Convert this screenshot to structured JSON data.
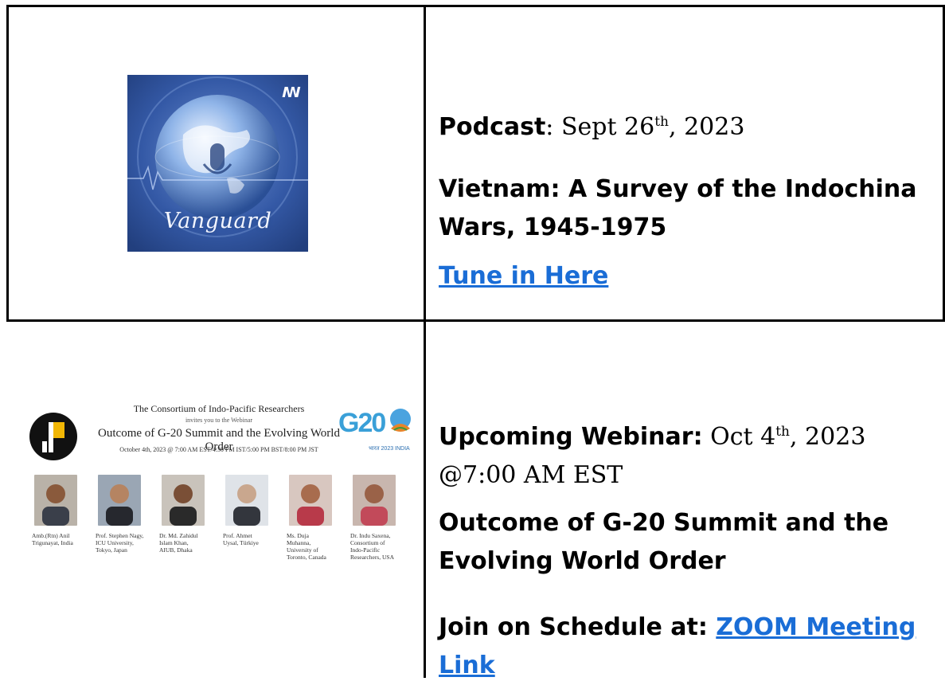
{
  "podcast": {
    "cover_name": "Vanguard",
    "label": "Podcast",
    "date_prefix": ": Sept 26",
    "date_sup": "th",
    "date_suffix": ", 2023",
    "title_line1": "Vietnam: A Survey of the Indochina",
    "title_line2": "Wars, 1945-1975",
    "link": "Tune in Here"
  },
  "webinar": {
    "label": "Upcoming Webinar:",
    "date_prefix": " Oct 4",
    "date_sup": "th",
    "date_suffix": ", 2023",
    "time": "@7:00 AM EST",
    "title_line1": "Outcome of G-20 Summit and the",
    "title_line2": "Evolving World Order",
    "join_label": "Join on Schedule at: ",
    "link_part1": "ZOOM Meeting",
    "link_part2": "Link"
  },
  "flyer": {
    "org": "The Consortium of Indo-Pacific Researchers",
    "invite": "invites you to the Webinar",
    "title": "Outcome of G-20 Summit and the Evolving World Order",
    "date": "October 4th, 2023 @ 7:00 AM EST/4:30 PM IST/5:00 PM BST/8:00 PM JST",
    "g20_mark": "G20",
    "g20_sub": "भारत 2023 INDIA",
    "speakers": [
      "Amb.(Rtn) Anil\nTrigunayat, India",
      "Prof. Stephen Nagy,\nICU University,\nTokyo, Japan",
      "Dr. Md. Zahidul\nIslam Khan,\nAIUB, Dhaka",
      "Prof. Ahmet\nUysal, Türkiye",
      "Ms. Duja\nMuhanna,\nUniversity of\nToronto, Canada",
      "Dr. Indu Saxena,\nConsortium of\nIndo-Pacific\nResearchers, USA"
    ]
  },
  "colors": {
    "link": "#1a6dd6",
    "cover_bg": "#2f55a0",
    "g20_blue": "#3aa0d8"
  }
}
